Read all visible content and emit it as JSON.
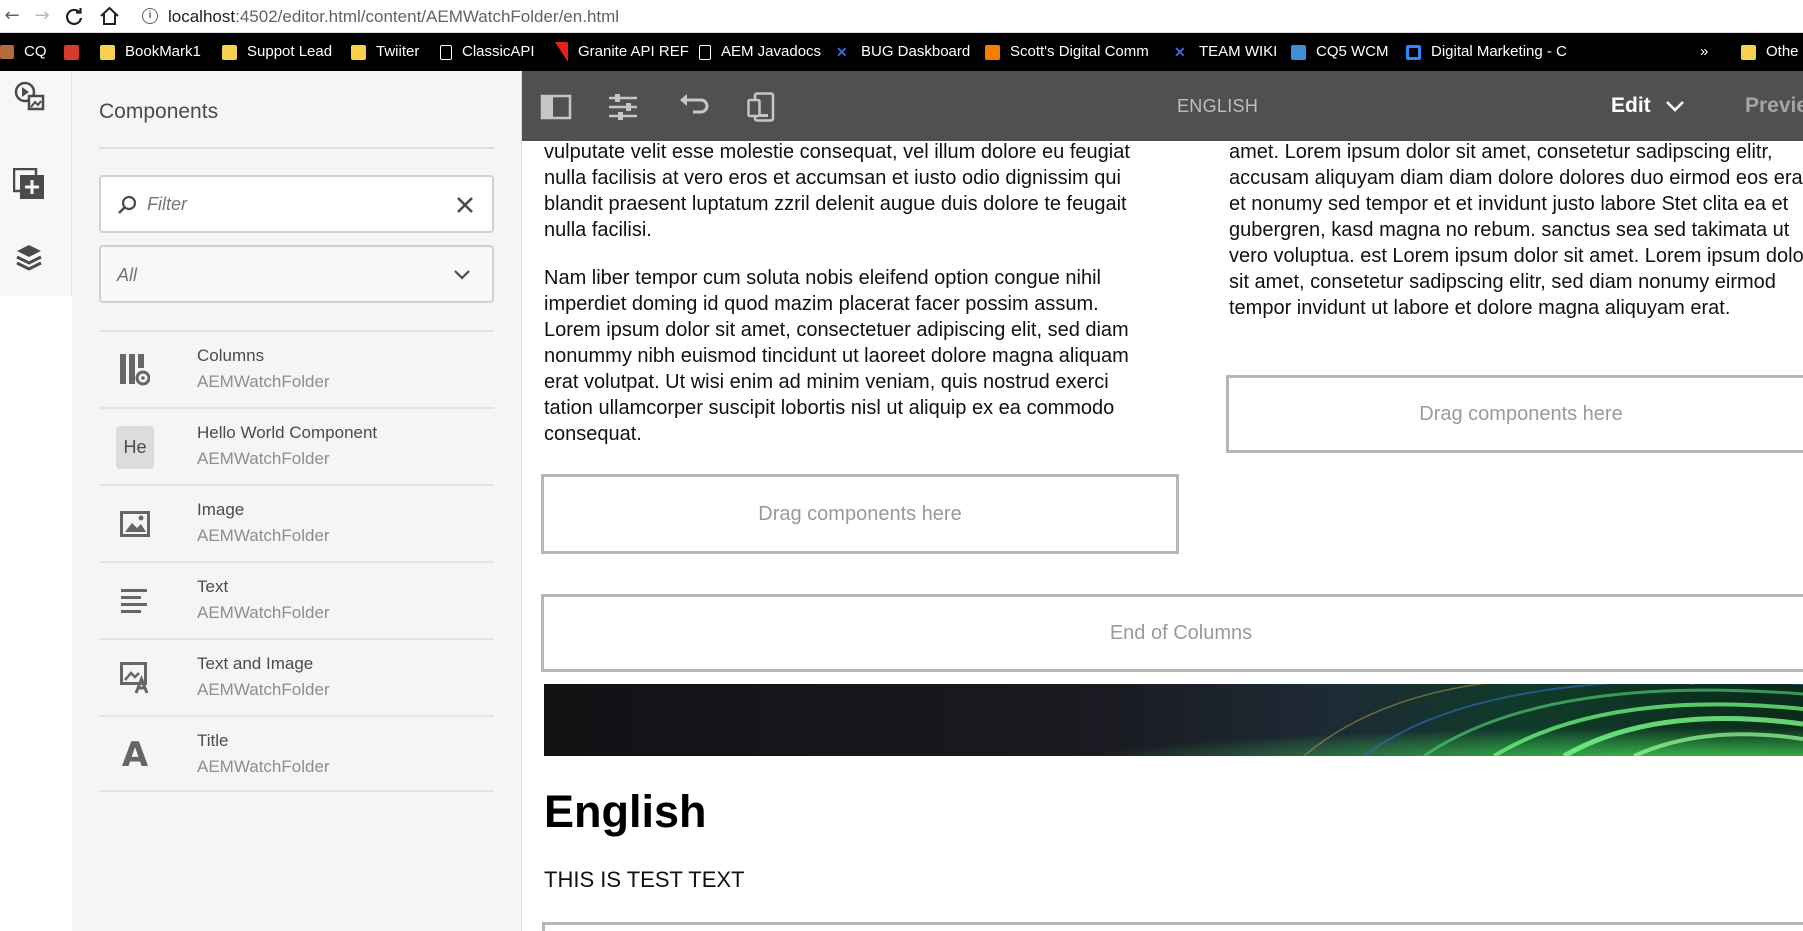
{
  "browser": {
    "url_host": "localhost",
    "url_rest": ":4502/editor.html/content/AEMWatchFolder/en.html",
    "bookmarks": [
      {
        "label": "CQ",
        "icon": "cq-icon"
      },
      {
        "label": "",
        "icon": "bag-icon"
      },
      {
        "label": "BookMark1",
        "icon": "folder-icon"
      },
      {
        "label": "Suppot Lead",
        "icon": "folder-icon"
      },
      {
        "label": "Twiiter",
        "icon": "folder-icon"
      },
      {
        "label": "ClassicAPI",
        "icon": "page-icon"
      },
      {
        "label": "Granite API REF",
        "icon": "adobe-icon"
      },
      {
        "label": "AEM Javadocs",
        "icon": "page-icon"
      },
      {
        "label": "BUG Daskboard",
        "icon": "x-icon"
      },
      {
        "label": "Scott's Digital Comm",
        "icon": "blogger-icon"
      },
      {
        "label": "TEAM WIKI",
        "icon": "x-icon"
      },
      {
        "label": "CQ5 WCM",
        "icon": "globe-icon"
      },
      {
        "label": "Digital Marketing - C",
        "icon": "ring-icon"
      }
    ],
    "overflow": "»",
    "other_bookmarks": "Othe"
  },
  "panel": {
    "title": "Components",
    "filter_placeholder": "Filter",
    "group_value": "All",
    "components": [
      {
        "name": "Columns",
        "group": "AEMWatchFolder",
        "icon": "columns-icon"
      },
      {
        "name": "Hello World Component",
        "group": "AEMWatchFolder",
        "icon": "he-badge-icon",
        "badge": "He"
      },
      {
        "name": "Image",
        "group": "AEMWatchFolder",
        "icon": "image-icon"
      },
      {
        "name": "Text",
        "group": "AEMWatchFolder",
        "icon": "text-icon"
      },
      {
        "name": "Text and Image",
        "group": "AEMWatchFolder",
        "icon": "text-image-icon"
      },
      {
        "name": "Title",
        "group": "AEMWatchFolder",
        "icon": "title-icon",
        "glyph": "A"
      }
    ]
  },
  "toolbar": {
    "page_name": "ENGLISH",
    "mode": "Edit",
    "preview": "Preview"
  },
  "page": {
    "left_para_1": "vulputate velit esse molestie consequat, vel illum dolore eu feugiat nulla facilisis at vero eros et accumsan et iusto odio dignissim qui blandit praesent luptatum zzril delenit augue duis dolore te feugait nulla facilisi.",
    "left_para_2": "Nam liber tempor cum soluta nobis eleifend option congue nihil imperdiet doming id quod mazim placerat facer possim assum. Lorem ipsum dolor sit amet, consectetuer adipiscing elit, sed diam nonummy nibh euismod tincidunt ut laoreet dolore magna aliquam erat volutpat. Ut wisi enim ad minim veniam, quis nostrud exerci tation ullamcorper suscipit lobortis nisl ut aliquip ex ea commodo consequat.",
    "right_para": "amet. Lorem ipsum dolor sit amet, consetetur sadipscing elitr, accusam aliquyam diam diam dolore dolores duo eirmod eos erat, et nonumy sed tempor et et invidunt justo labore Stet clita ea et gubergren, kasd magna no rebum. sanctus sea sed takimata ut vero voluptua. est Lorem ipsum dolor sit amet. Lorem ipsum dolor sit amet, consetetur sadipscing elitr, sed diam nonumy eirmod tempor invidunt ut labore et dolore magna aliquyam erat.",
    "drop_left": "Drag components here",
    "drop_right": "Drag components here",
    "end_columns": "End of Columns",
    "heading": "English",
    "body_text": "THIS IS TEST TEXT"
  },
  "colors": {
    "toolbar_bg": "#505050",
    "panel_bg": "#f5f5f5",
    "bookmark_bar_bg": "#000000",
    "drop_border": "#b6b6b6"
  }
}
